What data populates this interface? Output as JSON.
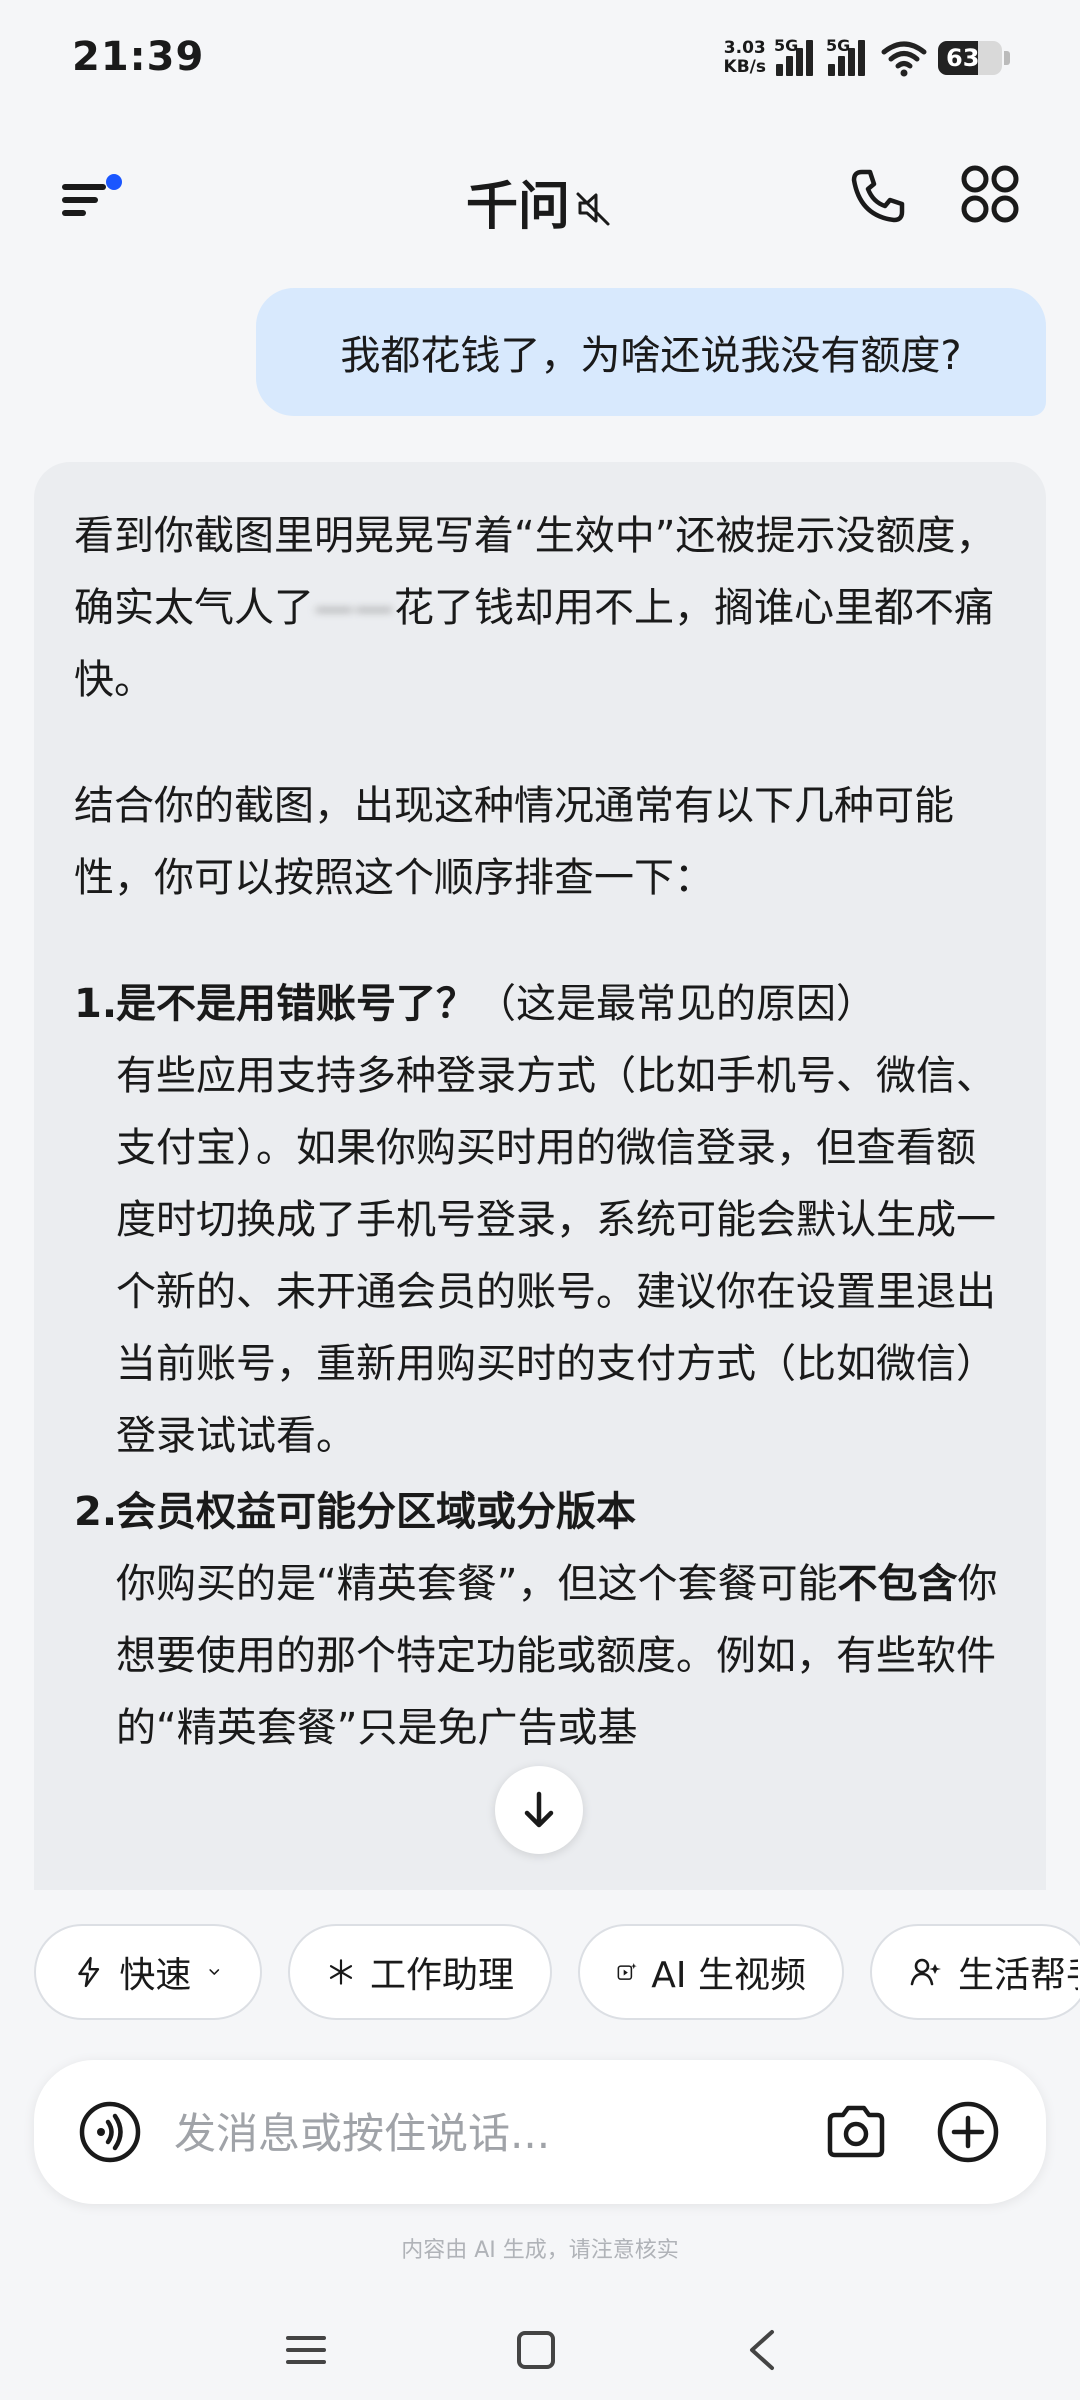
{
  "status_bar": {
    "time": "21:39",
    "net_speed_value": "3.03",
    "net_speed_unit": "KB/s",
    "signal1_label": "5G",
    "signal2_label": "5G",
    "battery": "63"
  },
  "header": {
    "title": "千问"
  },
  "chat": {
    "user_message": "我都花钱了，为啥还说我没有额度?",
    "ai": {
      "p1_before_blur": "看到你截图里明晃晃写着“生效中”还被提示没额度，确实太气人了",
      "p1_blurred": "——",
      "p1_after_blur": "花了钱却用不上，搁谁心里都不痛快。",
      "p2": "结合你的截图，出现这种情况通常有以下几种可能性，你可以按照这个顺序排查一下：",
      "item1": {
        "num": "1.",
        "title": "是不是用错账号了？",
        "title_note": "（这是最常见的原因）",
        "body": "有些应用支持多种登录方式（比如手机号、微信、支付宝）。如果你购买时用的微信登录，但查看额度时切换成了手机号登录，系统可能会默认生成一个新的、未开通会员的账号。建议你在设置里退出当前账号，重新用购买时的支付方式（比如微信）登录试试看。"
      },
      "item2": {
        "num": "2.",
        "title": "会员权益可能分区域或分版本",
        "body_before_bold": "你购买的是“精英套餐”，但这个套餐可能",
        "body_bold": "不包含",
        "body_after_bold": "你想要使用的那个特定功能或额度。例如，有些软件的“精英套餐”只是免广告或基"
      }
    }
  },
  "chips": [
    {
      "icon": "lightning-icon",
      "label": "快速",
      "has_dropdown": true
    },
    {
      "icon": "sparkle-icon",
      "label": "工作助理"
    },
    {
      "icon": "video-ai-icon",
      "label": "AI 生视频"
    },
    {
      "icon": "life-helper-icon",
      "label": "生活帮手"
    }
  ],
  "input": {
    "placeholder": "发消息或按住说话..."
  },
  "disclaimer": "内容由 AI 生成，请注意核实"
}
